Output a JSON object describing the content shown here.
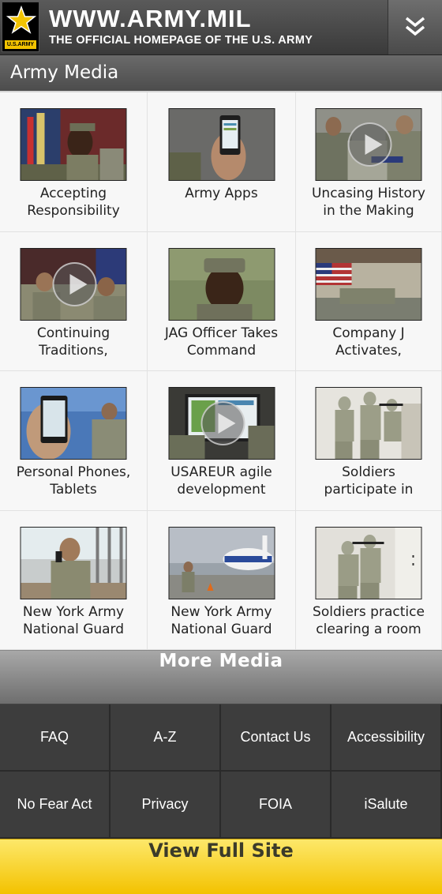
{
  "header": {
    "logo_text": "U.S.ARMY",
    "title": "WWW.ARMY.MIL",
    "subtitle": "THE OFFICIAL HOMEPAGE OF THE U.S. ARMY",
    "menu_icon": "double-chevron-down-icon"
  },
  "section": {
    "title": "Army Media"
  },
  "media": [
    {
      "caption_line1": "Accepting",
      "caption_line2": "Responsibility",
      "video": false
    },
    {
      "caption_line1": "Army Apps",
      "caption_line2": "",
      "video": false
    },
    {
      "caption_line1": "Uncasing History",
      "caption_line2": "in the Making",
      "video": true
    },
    {
      "caption_line1": "Continuing",
      "caption_line2": "Traditions,",
      "video": true
    },
    {
      "caption_line1": "JAG Officer Takes",
      "caption_line2": "Command",
      "video": false
    },
    {
      "caption_line1": "Company J",
      "caption_line2": "Activates,",
      "video": false
    },
    {
      "caption_line1": "Personal Phones,",
      "caption_line2": "Tablets",
      "video": false
    },
    {
      "caption_line1": "USAREUR agile",
      "caption_line2": "development",
      "video": true
    },
    {
      "caption_line1": "Soldiers",
      "caption_line2": "participate in",
      "video": false
    },
    {
      "caption_line1": "New York Army",
      "caption_line2": "National Guard",
      "video": false
    },
    {
      "caption_line1": "New York Army",
      "caption_line2": "National Guard",
      "video": false
    },
    {
      "caption_line1": "Soldiers practice",
      "caption_line2": "clearing a room",
      "video": false
    }
  ],
  "more_media_label": "More Media",
  "footer_links": [
    "FAQ",
    "A-Z",
    "Contact Us",
    "Accessibility",
    "No Fear Act",
    "Privacy",
    "FOIA",
    "iSalute"
  ],
  "full_site_label": "View Full Site",
  "colors": {
    "header_bg": "#4a4a4a",
    "footer_cell": "#3d3d3d",
    "full_site_yellow": "#f7d21e",
    "logo_gold": "#f2c300"
  }
}
